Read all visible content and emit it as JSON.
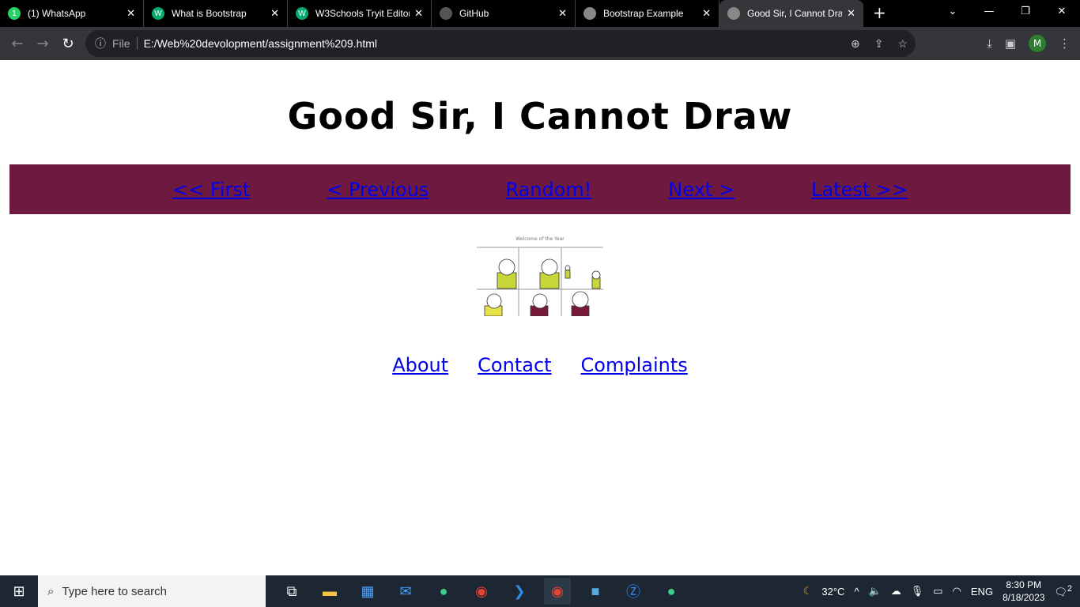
{
  "browser": {
    "tabs": [
      {
        "label": "(1) WhatsApp",
        "icon": "whatsapp-icon",
        "color": "#25d366",
        "glyph": "1"
      },
      {
        "label": "What is Bootstrap",
        "icon": "w3schools-icon",
        "color": "#04aa6d",
        "glyph": "W"
      },
      {
        "label": "W3Schools Tryit Editor",
        "icon": "w3schools-icon",
        "color": "#04aa6d",
        "glyph": "W"
      },
      {
        "label": "GitHub",
        "icon": "github-icon",
        "color": "#555",
        "glyph": ""
      },
      {
        "label": "Bootstrap Example",
        "icon": "globe-icon",
        "color": "#888",
        "glyph": ""
      },
      {
        "label": "Good Sir, I Cannot Draw",
        "icon": "globe-icon",
        "color": "#888",
        "glyph": ""
      }
    ],
    "active_tab": 5,
    "file_label": "File",
    "url": "E:/Web%20devolopment/assignment%209.html",
    "profile_initial": "M"
  },
  "page": {
    "title": "Good Sir, I Cannot Draw",
    "nav": [
      "<< First",
      "< Previous",
      "Random!",
      "Next >",
      "Latest >>"
    ],
    "comic_caption": "Welcome of the Year",
    "footer": [
      "About",
      "Contact",
      "Complaints"
    ],
    "colors": {
      "nav_bg": "#6e193f",
      "link": "#0000ee"
    }
  },
  "taskbar": {
    "search_placeholder": "Type here to search",
    "weather": "32°C",
    "language": "ENG",
    "time": "8:30 PM",
    "date": "8/18/2023",
    "notifications": "2"
  }
}
